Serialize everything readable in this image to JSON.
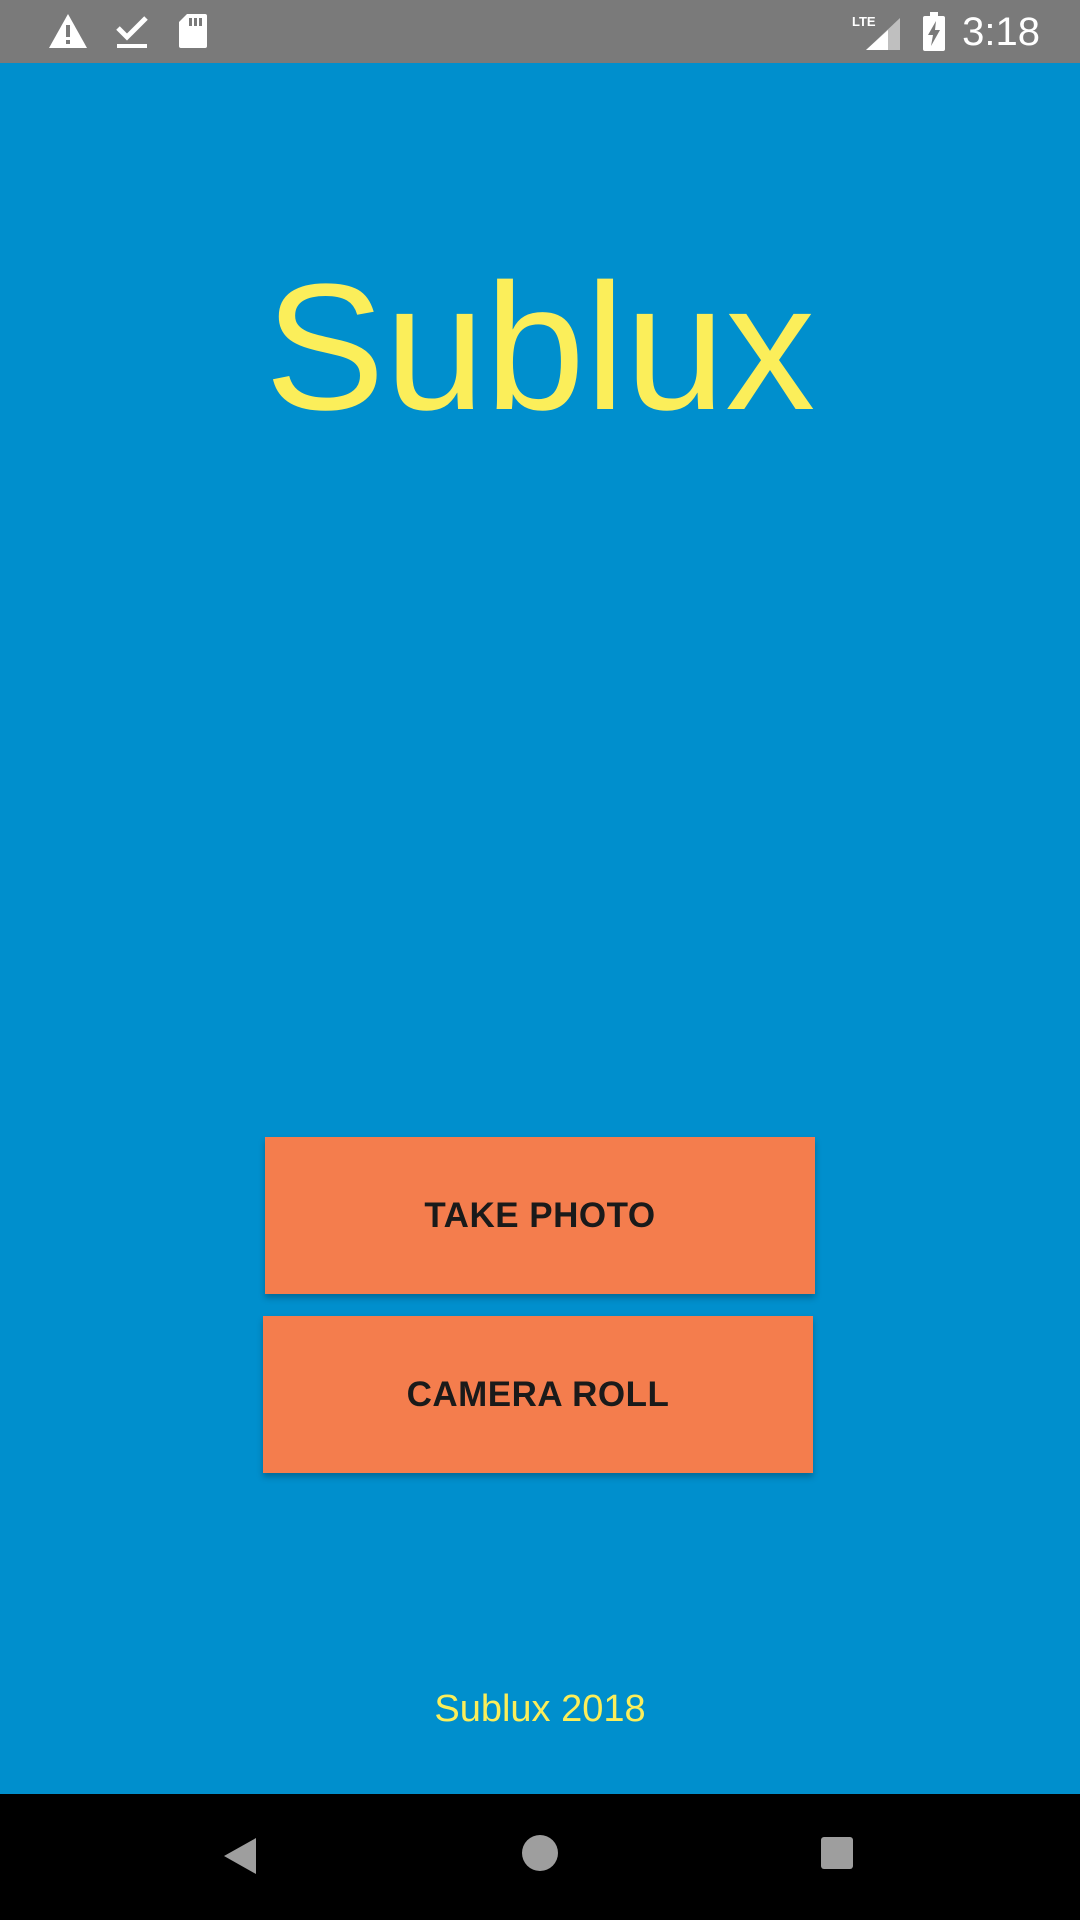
{
  "status_bar": {
    "time": "3:18",
    "network_label": "LTE",
    "icons": [
      "warning-icon",
      "download-done-icon",
      "sd-card-icon",
      "lte-signal-icon",
      "battery-charging-icon"
    ]
  },
  "app": {
    "title": "Sublux",
    "buttons": {
      "take_photo": "TAKE PHOTO",
      "camera_roll": "CAMERA ROLL"
    },
    "footer": "Sublux 2018"
  },
  "nav_bar": {
    "icons": [
      "back-icon",
      "home-icon",
      "recents-icon"
    ]
  },
  "colors": {
    "background": "#008fcd",
    "title": "#fbee5a",
    "button": "#f47d4d",
    "status_bar": "#7a7a7a",
    "nav_bar": "#000000"
  }
}
